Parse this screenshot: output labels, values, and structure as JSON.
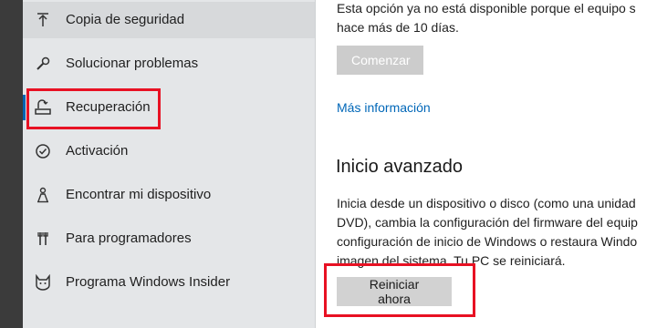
{
  "sidebar": {
    "items": [
      {
        "label": "Copia de seguridad",
        "icon": "upload-icon"
      },
      {
        "label": "Solucionar problemas",
        "icon": "wrench-icon"
      },
      {
        "label": "Recuperación",
        "icon": "recovery-icon",
        "active": true
      },
      {
        "label": "Activación",
        "icon": "check-circle-icon"
      },
      {
        "label": "Encontrar mi dispositivo",
        "icon": "person-locate-icon"
      },
      {
        "label": "Para programadores",
        "icon": "developer-tools-icon"
      },
      {
        "label": "Programa Windows Insider",
        "icon": "insider-cat-icon"
      }
    ]
  },
  "main": {
    "goback_text": [
      "Esta opción ya no está disponible porque el equipo s",
      "hace más de 10 días."
    ],
    "start_button": "Comenzar",
    "more_info_link": "Más información",
    "advanced_title": "Inicio avanzado",
    "advanced_text": [
      "Inicia desde un dispositivo o disco (como una unidad",
      "DVD), cambia la configuración del firmware del equip",
      "configuración de inicio de Windows o restaura Windo",
      "imagen del sistema. Tu PC se reiniciará."
    ],
    "restart_button": "Reiniciar ahora"
  },
  "colors": {
    "accent": "#0063b1",
    "highlight": "#e81123",
    "link": "#0067b8",
    "sidebar_bg": "#e4e6e8"
  }
}
